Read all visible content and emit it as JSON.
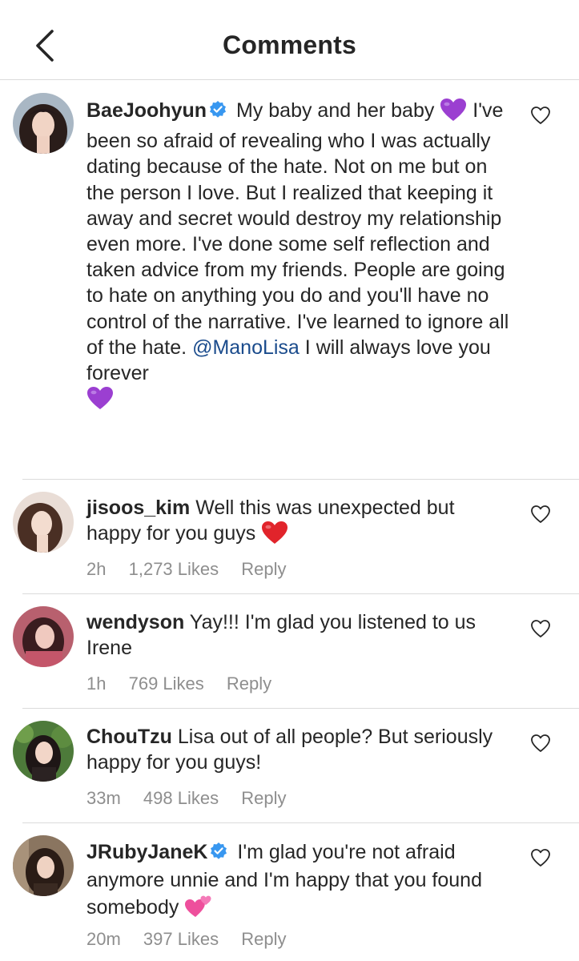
{
  "header": {
    "title": "Comments"
  },
  "comments": [
    {
      "username": "BaeJoohyun",
      "verified": true,
      "text_1": "My baby and her baby",
      "text_2": "I've been so afraid of revealing who I was actually dating because of the hate. Not on me but on the person I love. But I realized that keeping it away and secret would destroy my relationship even more. I've done some self reflection and taken advice from my friends. People are going to hate on anything you do and you'll have no control of the narrative. I've learned to ignore all of the hate.",
      "mention": "@ManoLisa",
      "text_3": "I will always love you forever"
    },
    {
      "username": "jisoos_kim",
      "verified": false,
      "text": "Well this was unexpected but happy for you guys",
      "time": "2h",
      "likes": "1,273 Likes",
      "reply": "Reply"
    },
    {
      "username": "wendyson",
      "verified": false,
      "text": "Yay!!! I'm glad you listened to us Irene",
      "time": "1h",
      "likes": "769 Likes",
      "reply": "Reply"
    },
    {
      "username": "ChouTzu",
      "verified": false,
      "text": "Lisa out of all people? But seriously happy for you guys!",
      "time": "33m",
      "likes": "498 Likes",
      "reply": "Reply"
    },
    {
      "username": "JRubyJaneK",
      "verified": true,
      "text": "I'm glad you're not afraid anymore unnie and I'm happy that you found somebody",
      "time": "20m",
      "likes": "397 Likes",
      "reply": "Reply"
    }
  ],
  "colors": {
    "mention": "#1a4b8c",
    "meta": "#8e8e8e",
    "verified": "#3897f0",
    "divider": "#dbdbdb"
  }
}
